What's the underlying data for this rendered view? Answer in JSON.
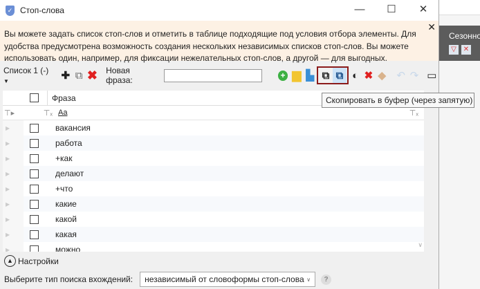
{
  "background": {
    "column_header": "Сезонность"
  },
  "window": {
    "title": "Стоп-слова",
    "minimize": "—",
    "maximize": "☐",
    "close": "✕"
  },
  "banner": {
    "text": "Вы можете задать список стоп-слов и отметить в таблице подходящие под условия отбора элементы. Для удобства предусмотрена возможность создания нескольких независимых списков стоп-слов. Вы можете использовать один, например, для фиксации нежелательных стоп-слов, а другой — для выгодных.",
    "close": "✕"
  },
  "toolbar": {
    "list_select": "Список 1 (-)",
    "new_phrase_label": "Новая фраза:",
    "new_phrase_value": ""
  },
  "table": {
    "header_phrase": "Фраза",
    "filter_text": "Aa",
    "rows": [
      "вакансия",
      "работа",
      "+как",
      "делают",
      "+что",
      "какие",
      "какой",
      "какая",
      "можно"
    ]
  },
  "tooltip": "Скопировать в буфер (через запятую)",
  "settings": {
    "label": "Настройки"
  },
  "search_type": {
    "label": "Выберите тип поиска вхождений:",
    "value": "независимый от словоформы стоп-слова",
    "help": "?"
  }
}
